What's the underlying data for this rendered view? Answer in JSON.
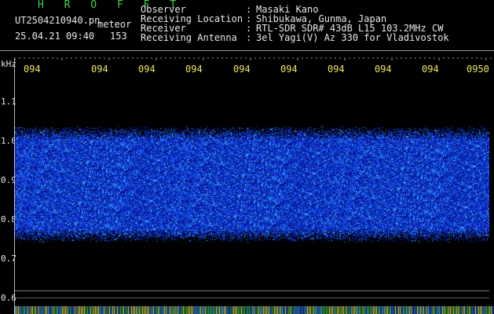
{
  "header": {
    "app": "H R O F F T",
    "filename": "UT2504210940.pn",
    "kind": "meteor",
    "datetime": "25.04.21 09:40",
    "count": "153",
    "fields": [
      {
        "label": "Observer",
        "value": "Masaki Kano"
      },
      {
        "label": "Receiving Location",
        "value": "Shibukawa, Gunma, Japan"
      },
      {
        "label": "Receiver",
        "value": "RTL-SDR SDR# 43dB L15 103.2MHz CW"
      },
      {
        "label": "Receiving Antenna",
        "value": "3el Yagi(V) Az 330 for Vladivostok"
      }
    ]
  },
  "time_axis": {
    "labels": [
      "094",
      "094",
      "094",
      "094",
      "094",
      "094",
      "094",
      "094",
      "094",
      "0950"
    ]
  },
  "freq_axis": {
    "unit": "kHz",
    "labels": [
      "1.1",
      "1.0",
      "0.9",
      "0.8",
      "0.7",
      "0.6"
    ]
  },
  "colors": {
    "signal_low": "#0a1a9e",
    "signal_mid": "#1e5cff",
    "signal_high": "#4fd0ff",
    "time_label": "#e8e860",
    "title_green": "#3fd24a"
  }
}
